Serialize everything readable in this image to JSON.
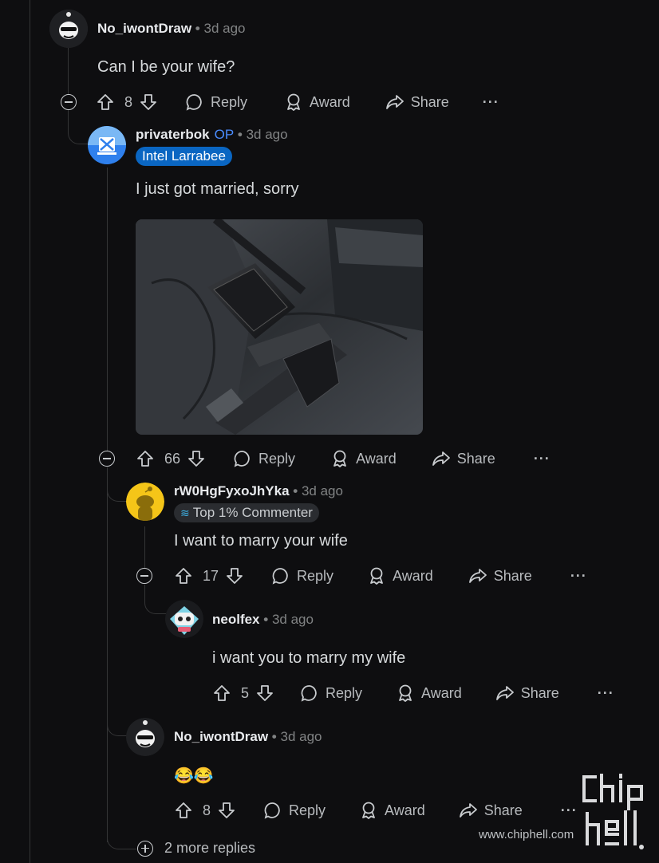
{
  "comments": [
    {
      "user": "No_iwontDraw",
      "time": "3d ago",
      "text": "Can I be your wife?",
      "votes": "8",
      "reply": "Reply",
      "award": "Award",
      "share": "Share"
    },
    {
      "user": "privaterbok",
      "op_badge": "OP",
      "time": "3d ago",
      "flair": "Intel Larrabee",
      "text": "I just got married, sorry",
      "votes": "66",
      "reply": "Reply",
      "award": "Award",
      "share": "Share"
    },
    {
      "user": "rW0HgFyxoJhYka",
      "time": "3d ago",
      "flair": "Top 1% Commenter",
      "text": "I want to marry your wife",
      "votes": "17",
      "reply": "Reply",
      "award": "Award",
      "share": "Share"
    },
    {
      "user": "neolfex",
      "time": "3d ago",
      "text": "i want you to marry my wife",
      "votes": "5",
      "reply": "Reply",
      "award": "Award",
      "share": "Share"
    },
    {
      "user": "No_iwontDraw",
      "time": "3d ago",
      "text": "😂😂",
      "votes": "8",
      "reply": "Reply",
      "award": "Award",
      "share": "Share"
    }
  ],
  "more_replies": "2 more replies",
  "more_menu": "···",
  "watermark": {
    "site": "www.chiphell.com",
    "logo": "chip hell"
  },
  "colors": {
    "background": "#0e0e10",
    "op": "#4a8cff",
    "flair_blue": "#0a66c2",
    "line": "#343536"
  }
}
